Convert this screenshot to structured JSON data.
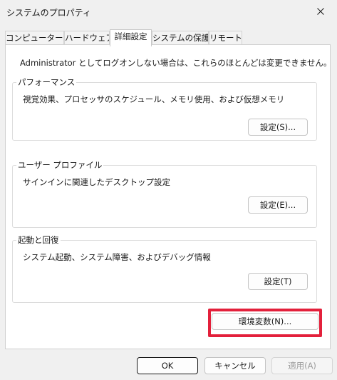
{
  "window": {
    "title": "システムのプロパティ",
    "close_glyph": "✕"
  },
  "tabs": [
    {
      "label": "コンピューター名"
    },
    {
      "label": "ハードウェア"
    },
    {
      "label": "詳細設定"
    },
    {
      "label": "システムの保護"
    },
    {
      "label": "リモート"
    }
  ],
  "active_tab": "詳細設定",
  "admin_note": "Administrator としてログオンしない場合は、これらのほとんどは変更できません。",
  "performance": {
    "title": "パフォーマンス",
    "description": "視覚効果、プロセッサのスケジュール、メモリ使用、および仮想メモリ",
    "button": "設定(S)..."
  },
  "user_profile": {
    "title": "ユーザー プロファイル",
    "description": "サインインに関連したデスクトップ設定",
    "button": "設定(E)..."
  },
  "startup_recovery": {
    "title": "起動と回復",
    "description": "システム起動、システム障害、およびデバッグ情報",
    "button": "設定(T)"
  },
  "env_vars_button": "環境変数(N)...",
  "footer": {
    "ok": "OK",
    "cancel": "キャンセル",
    "apply": "適用(A)"
  },
  "colors": {
    "highlight": "#e3203b"
  }
}
